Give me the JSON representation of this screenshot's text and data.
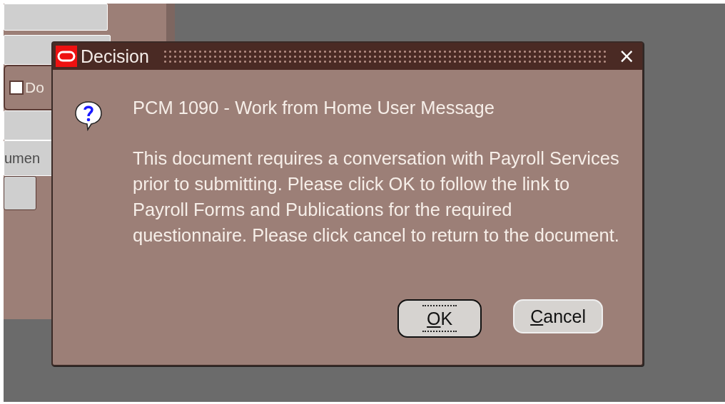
{
  "background_form": {
    "checkbox": {
      "label": "Do",
      "checked": false
    },
    "field_text": "umen"
  },
  "dialog": {
    "title": "Decision",
    "close": "×",
    "heading": "PCM 1090 - Work from Home User Message",
    "message": "This document requires a conversation with Payroll Services prior to submitting. Please click OK to follow the link to Payroll Forms and Publications for the required questionnaire. Please click cancel to return to the document.",
    "buttons": [
      {
        "label": "OK",
        "focused": true
      },
      {
        "label": "Cancel",
        "focused": false
      }
    ]
  }
}
